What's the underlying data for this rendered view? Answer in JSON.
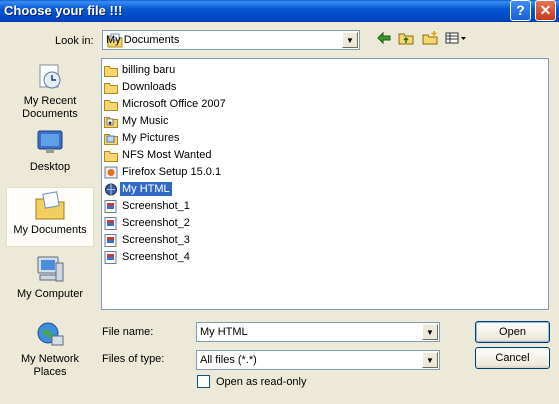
{
  "window": {
    "title": "Choose your file !!!",
    "help_glyph": "?",
    "close_glyph": "✕"
  },
  "toolbar": {
    "lookin_label": "Look in:",
    "lookin_value": "My Documents",
    "back_icon": "back-arrow-icon",
    "up_icon": "up-folder-icon",
    "newfolder_icon": "new-folder-icon",
    "views_icon": "views-menu-icon"
  },
  "places": [
    {
      "label": "My Recent Documents",
      "icon": "recent-documents-icon"
    },
    {
      "label": "Desktop",
      "icon": "desktop-icon"
    },
    {
      "label": "My Documents",
      "icon": "my-documents-icon",
      "selected": true
    },
    {
      "label": "My Computer",
      "icon": "my-computer-icon"
    },
    {
      "label": "My Network Places",
      "icon": "network-places-icon"
    }
  ],
  "files": [
    {
      "name": "billing baru",
      "type": "folder"
    },
    {
      "name": "Downloads",
      "type": "folder"
    },
    {
      "name": "Microsoft Office 2007",
      "type": "folder"
    },
    {
      "name": "My Music",
      "type": "music-folder"
    },
    {
      "name": "My Pictures",
      "type": "pictures-folder"
    },
    {
      "name": "NFS Most Wanted",
      "type": "folder"
    },
    {
      "name": "Firefox Setup 15.0.1",
      "type": "installer"
    },
    {
      "name": "My HTML",
      "type": "html-file",
      "selected": true
    },
    {
      "name": "Screenshot_1",
      "type": "image"
    },
    {
      "name": "Screenshot_2",
      "type": "image"
    },
    {
      "name": "Screenshot_3",
      "type": "image"
    },
    {
      "name": "Screenshot_4",
      "type": "image"
    }
  ],
  "form": {
    "filename_label": "File name:",
    "filename_value": "My HTML",
    "filetype_label": "Files of type:",
    "filetype_value": "All files (*.*)",
    "readonly_label": "Open as read-only",
    "readonly_checked": false
  },
  "buttons": {
    "open": "Open",
    "cancel": "Cancel"
  },
  "colors": {
    "titlebar": "#0054e3",
    "selection": "#316ac5",
    "dialog_bg": "#ece9d8"
  }
}
